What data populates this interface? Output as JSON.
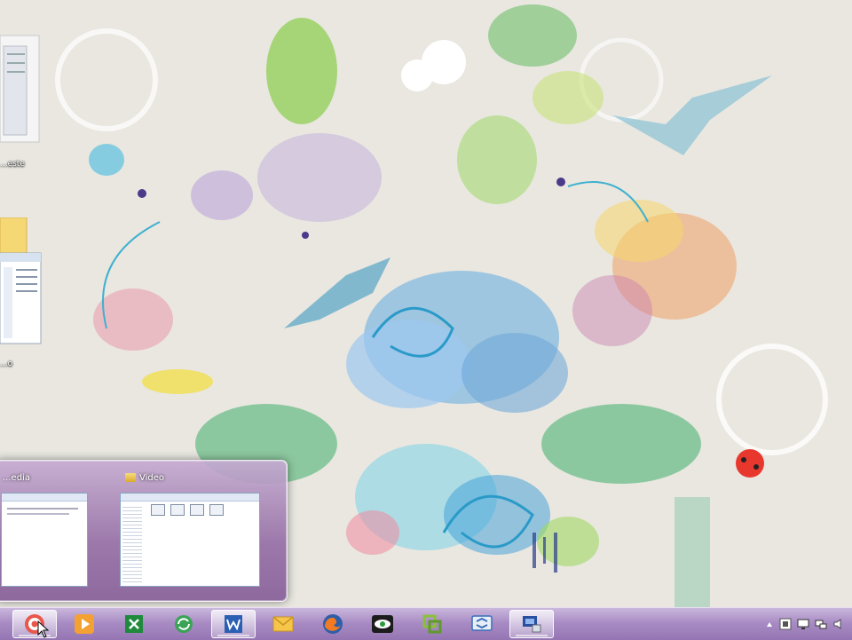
{
  "desktop": {
    "icons": [
      {
        "name": "folder-documents",
        "label": "...este"
      },
      {
        "name": "folder-explorer",
        "label": "...o"
      }
    ]
  },
  "peek": {
    "thumbnails": [
      {
        "title": "...edia"
      },
      {
        "title": "Video"
      }
    ]
  },
  "taskbar": {
    "apps": [
      {
        "name": "target-app",
        "icon": "target-icon"
      },
      {
        "name": "media-player",
        "icon": "play-icon"
      },
      {
        "name": "excel",
        "icon": "excel-icon"
      },
      {
        "name": "sync-app",
        "icon": "sync-icon"
      },
      {
        "name": "word",
        "icon": "word-icon"
      },
      {
        "name": "outlook",
        "icon": "mail-icon"
      },
      {
        "name": "firefox",
        "icon": "firefox-icon"
      },
      {
        "name": "eye-app",
        "icon": "eye-icon"
      },
      {
        "name": "vmware",
        "icon": "vmware-icon"
      },
      {
        "name": "remote-app",
        "icon": "remote-icon"
      },
      {
        "name": "network-app",
        "icon": "network-icon"
      }
    ],
    "tray": [
      "show-hidden-icon",
      "tray-app-icon",
      "tray-display-icon",
      "network-status-icon",
      "volume-icon"
    ]
  },
  "colors": {
    "taskbar": "#a98cc4",
    "peek": "#9a7ab0",
    "wallpaper_bg": "#e9e7e0"
  }
}
